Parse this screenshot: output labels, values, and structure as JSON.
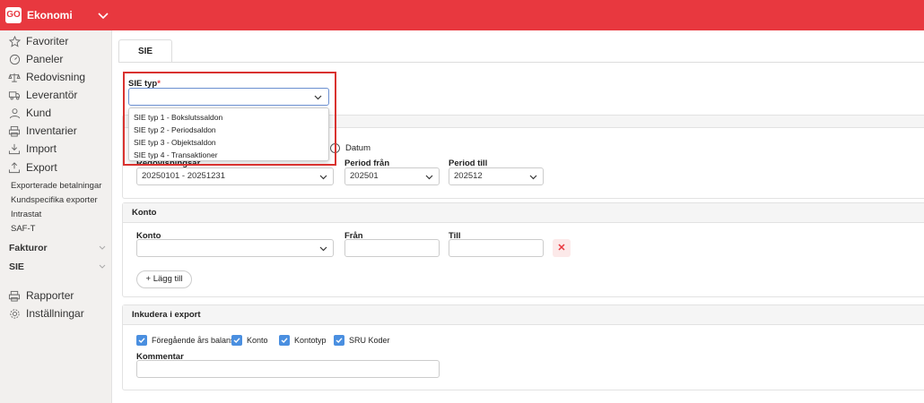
{
  "app": {
    "logo": "GO",
    "name": "Ekonomi"
  },
  "sidebar": {
    "items": [
      {
        "label": "Favoriter",
        "icon": "star-icon"
      },
      {
        "label": "Paneler",
        "icon": "gauge-icon"
      },
      {
        "label": "Redovisning",
        "icon": "scale-icon"
      },
      {
        "label": "Leverantör",
        "icon": "truck-icon"
      },
      {
        "label": "Kund",
        "icon": "user-icon"
      },
      {
        "label": "Inventarier",
        "icon": "printer-icon"
      },
      {
        "label": "Import",
        "icon": "import-icon"
      },
      {
        "label": "Export",
        "icon": "export-icon"
      }
    ],
    "export_sub": [
      "Exporterade betalningar",
      "Kundspecifika exporter",
      "Intrastat",
      "SAF-T"
    ],
    "groups": [
      "Fakturor",
      "SIE"
    ],
    "bottom_items": [
      {
        "label": "Rapporter",
        "icon": "print-icon"
      },
      {
        "label": "Inställningar",
        "icon": "settings-icon"
      }
    ]
  },
  "tab": "SIE",
  "sie": {
    "label": "SIE typ",
    "required_mark": "*",
    "options": [
      "SIE typ 1 - Bokslutssaldon",
      "SIE typ 2 - Periodsaldon",
      "SIE typ 3 - Objektsaldon",
      "SIE typ 4 - Transaktioner"
    ]
  },
  "period": {
    "radio_label": "Datum",
    "year_label": "Redovisningsår",
    "year_value": "20250101 - 20251231",
    "from_label": "Period från",
    "from_value": "202501",
    "to_label": "Period till",
    "to_value": "202512"
  },
  "konto": {
    "header": "Konto",
    "konto_label": "Konto",
    "from_label": "Från",
    "to_label": "Till",
    "add_label": "+ Lägg till",
    "remove_glyph": "✕"
  },
  "include": {
    "header": "Inkudera i export",
    "checkboxes": [
      "Föregående års balanser",
      "Konto",
      "Kontotyp",
      "SRU Koder"
    ],
    "comment_label": "Kommentar"
  },
  "colors": {
    "brand": "#e8383f",
    "checkbox": "#4a8fe0"
  }
}
